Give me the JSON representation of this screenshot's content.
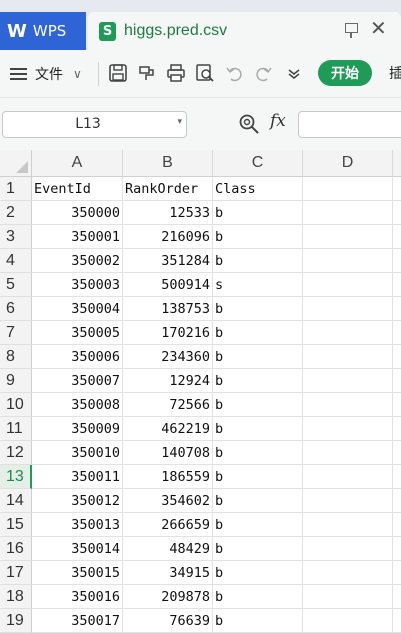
{
  "app": {
    "name": "WPS"
  },
  "tab": {
    "filename": "higgs.pred.csv",
    "file_icon_letter": "S"
  },
  "toolbar": {
    "menu_label": "文件",
    "start_label": "开始",
    "next_label": "插"
  },
  "formula_bar": {
    "cell_ref": "L13",
    "fx_label": "fx",
    "formula": ""
  },
  "grid": {
    "columns": [
      "A",
      "B",
      "C",
      "D"
    ],
    "active_row": 13,
    "rows": [
      {
        "num": "1",
        "a": "EventId",
        "b": "RankOrder",
        "c": "Class"
      },
      {
        "num": "2",
        "a": "350000",
        "b": "12533",
        "c": "b"
      },
      {
        "num": "3",
        "a": "350001",
        "b": "216096",
        "c": "b"
      },
      {
        "num": "4",
        "a": "350002",
        "b": "351284",
        "c": "b"
      },
      {
        "num": "5",
        "a": "350003",
        "b": "500914",
        "c": "s"
      },
      {
        "num": "6",
        "a": "350004",
        "b": "138753",
        "c": "b"
      },
      {
        "num": "7",
        "a": "350005",
        "b": "170216",
        "c": "b"
      },
      {
        "num": "8",
        "a": "350006",
        "b": "234360",
        "c": "b"
      },
      {
        "num": "9",
        "a": "350007",
        "b": "12924",
        "c": "b"
      },
      {
        "num": "10",
        "a": "350008",
        "b": "72566",
        "c": "b"
      },
      {
        "num": "11",
        "a": "350009",
        "b": "462219",
        "c": "b"
      },
      {
        "num": "12",
        "a": "350010",
        "b": "140708",
        "c": "b"
      },
      {
        "num": "13",
        "a": "350011",
        "b": "186559",
        "c": "b"
      },
      {
        "num": "14",
        "a": "350012",
        "b": "354602",
        "c": "b"
      },
      {
        "num": "15",
        "a": "350013",
        "b": "266659",
        "c": "b"
      },
      {
        "num": "16",
        "a": "350014",
        "b": "48429",
        "c": "b"
      },
      {
        "num": "17",
        "a": "350015",
        "b": "34915",
        "c": "b"
      },
      {
        "num": "18",
        "a": "350016",
        "b": "209878",
        "c": "b"
      },
      {
        "num": "19",
        "a": "350017",
        "b": "76639",
        "c": "b"
      }
    ]
  },
  "colors": {
    "wps_blue": "#2f64d6",
    "accent_green": "#1e9b57"
  }
}
